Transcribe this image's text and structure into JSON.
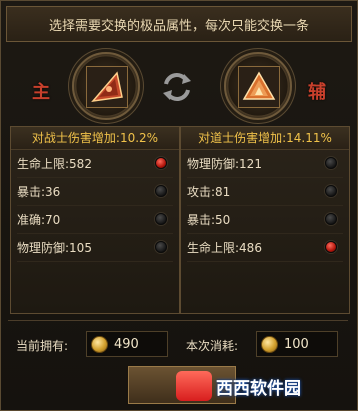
{
  "header": {
    "instruction": "选择需要交换的极品属性，每次只能交换一条"
  },
  "roles": {
    "main": "主",
    "aux": "辅"
  },
  "icons": {
    "gem_left": "red-gem-icon",
    "gem_right": "orange-gem-icon",
    "swap": "swap-arrows-icon",
    "coin": "gold-coin-icon"
  },
  "left_panel": {
    "title": "对战士伤害增加:10.2%",
    "rows": [
      {
        "label": "生命上限:582",
        "selected": true
      },
      {
        "label": "暴击:36",
        "selected": false
      },
      {
        "label": "准确:70",
        "selected": false
      },
      {
        "label": "物理防御:105",
        "selected": false
      }
    ]
  },
  "right_panel": {
    "title": "对道士伤害增加:14.11%",
    "rows": [
      {
        "label": "物理防御:121",
        "selected": false
      },
      {
        "label": "攻击:81",
        "selected": false
      },
      {
        "label": "暴击:50",
        "selected": false
      },
      {
        "label": "生命上限:486",
        "selected": true
      }
    ]
  },
  "footer": {
    "own_label": "当前拥有:",
    "own_value": "490",
    "cost_label": "本次消耗:",
    "cost_value": "100"
  },
  "watermark": {
    "text": "西西软件园"
  },
  "colors": {
    "accent": "#f0c24a",
    "selected_radio": "#d11d10",
    "frame": "#5a4a32"
  }
}
